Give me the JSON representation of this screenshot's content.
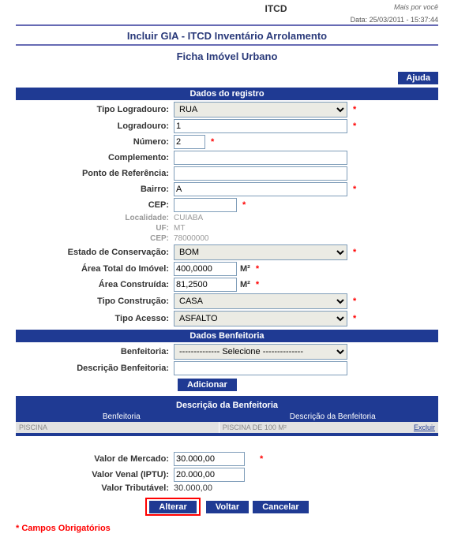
{
  "header": {
    "app": "ITCD",
    "slogan": "Mais por você",
    "date": "Data: 25/03/2011 - 15:37:44",
    "title": "Incluir GIA - ITCD Inventário Arrolamento",
    "subtitle": "Ficha Imóvel Urbano",
    "help": "Ajuda"
  },
  "sections": {
    "registro": "Dados do registro",
    "benfeitoria": "Dados Benfeitoria",
    "desc_benf": "Descrição da Benfeitoria"
  },
  "labels": {
    "tipo_log": "Tipo Logradouro:",
    "logradouro": "Logradouro:",
    "numero": "Número:",
    "complemento": "Complemento:",
    "ponto_ref": "Ponto de Referência:",
    "bairro": "Bairro:",
    "cep": "CEP:",
    "localidade": "Localidade:",
    "uf": "UF:",
    "cep_ro": "CEP:",
    "estado_cons": "Estado de Conservação:",
    "area_total": "Área Total do Imóvel:",
    "area_const": "Área Construída:",
    "tipo_const": "Tipo Construção:",
    "tipo_acesso": "Tipo Acesso:",
    "benf": "Benfeitoria:",
    "desc_benf": "Descrição Benfeitoria:",
    "valor_mercado": "Valor de Mercado:",
    "valor_iptu": "Valor Venal (IPTU):",
    "valor_trib": "Valor Tributável:"
  },
  "values": {
    "tipo_log": "RUA",
    "logradouro": "1",
    "numero": "2",
    "complemento": "",
    "ponto_ref": "",
    "bairro": "A",
    "cep": "",
    "localidade": "CUIABA",
    "uf": "MT",
    "cep_ro": "78000000",
    "estado_cons": "BOM",
    "area_total": "400,0000",
    "area_const": "81,2500",
    "tipo_const": "CASA",
    "tipo_acesso": "ASFALTO",
    "benf_placeholder": "-------------- Selecione --------------",
    "desc_benf": "",
    "valor_mercado": "30.000,00",
    "valor_iptu": "20.000,00",
    "valor_trib": "30.000,00",
    "m2": "M²"
  },
  "table": {
    "h1": "Benfeitoria",
    "h2": "Descrição da Benfeitoria",
    "rows": [
      {
        "c1": "PISCINA",
        "c2": "PISCINA DE 100 M²",
        "c3": "Excluir"
      }
    ]
  },
  "buttons": {
    "adicionar": "Adicionar",
    "alterar": "Alterar",
    "voltar": "Voltar",
    "cancelar": "Cancelar"
  },
  "note": "* Campos Obrigatórios"
}
